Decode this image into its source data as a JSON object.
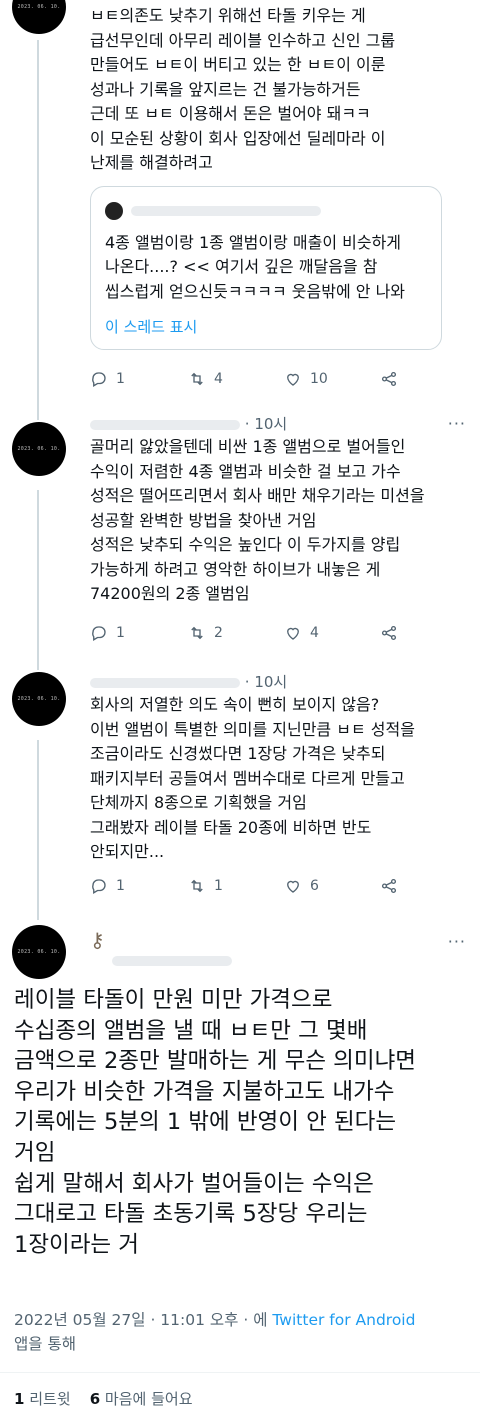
{
  "tweets": [
    {
      "avatar_text": "2023. 06. 10.",
      "text": "ㅂㅌ의존도 낮추기 위해선 타돌 키우는 게\n급선무인데 아무리 레이블 인수하고 신인 그룹\n만들어도 ㅂㅌ이 버티고 있는 한 ㅂㅌ이 이룬\n성과나 기록을 앞지르는 건 불가능하거든\n근데 또 ㅂㅌ 이용해서 돈은 벌어야 돼ㅋㅋ\n이 모순된 상황이 회사 입장에선 딜레마라 이\n난제를 해결하려고",
      "quote": {
        "text": "4종 앨범이랑 1종 앨범이랑 매출이 비슷하게\n나온다....? << 여기서 깊은 깨달음을 참\n씹스럽게 얻으신듯ㅋㅋㅋㅋ 웃음밖에 안 나와",
        "link": "이 스레드 표시"
      },
      "replies": "1",
      "retweets": "4",
      "likes": "10"
    },
    {
      "avatar_text": "2023. 06. 10.",
      "time": "· 10시",
      "text": "골머리 앓았을텐데 비싼 1종 앨범으로 벌어들인\n수익이 저렴한 4종 앨범과 비슷한 걸 보고 가수\n성적은 떨어뜨리면서 회사 배만 채우기라는 미션을\n성공할 완벽한 방법을 찾아낸 거임\n성적은 낮추되 수익은 높인다 이 두가지를 양립\n가능하게 하려고 영악한 하이브가 내놓은 게\n74200원의 2종 앨범임",
      "replies": "1",
      "retweets": "2",
      "likes": "4"
    },
    {
      "avatar_text": "2023. 06. 10.",
      "time": "· 10시",
      "text": "회사의 저열한 의도 속이 뻔히 보이지 않음?\n이번 앨범이 특별한 의미를 지닌만큼 ㅂㅌ 성적을\n조금이라도 신경썼다면 1장당 가격은 낮추되\n패키지부터 공들여서 멤버수대로 다르게 만들고\n단체까지 8종으로 기획했을 거임\n그래봤자 레이블 타돌 20종에 비하면 반도\n안되지만...",
      "replies": "1",
      "retweets": "1",
      "likes": "6"
    }
  ],
  "main": {
    "avatar_text": "2023. 06. 10.",
    "text": "레이블 타돌이 만원 미만 가격으로\n수십종의 앨범을 낼 때 ㅂㅌ만 그 몇배\n금액으로 2종만 발매하는 게 무슨 의미냐면\n우리가 비슷한 가격을 지불하고도 내가수\n기록에는 5분의 1 밖에 반영이 안 된다는\n거임\n쉽게 말해서 회사가 벌어들이는 수익은\n그대로고 타돌 초동기록 5장당 우리는\n1장이라는 거",
    "meta_date": "2022년 05월 27일 · 11:01 오후 · 에 ",
    "meta_source": "Twitter for Android",
    "meta_suffix": "앱을 통해",
    "retweet_count": "1",
    "retweet_label": "리트윗",
    "like_count": "6",
    "like_label": "마음에 들어요"
  },
  "colors": {
    "accent": "#1d9bf0",
    "muted": "#536471",
    "text": "#0f1419",
    "border": "#cfd9de"
  }
}
